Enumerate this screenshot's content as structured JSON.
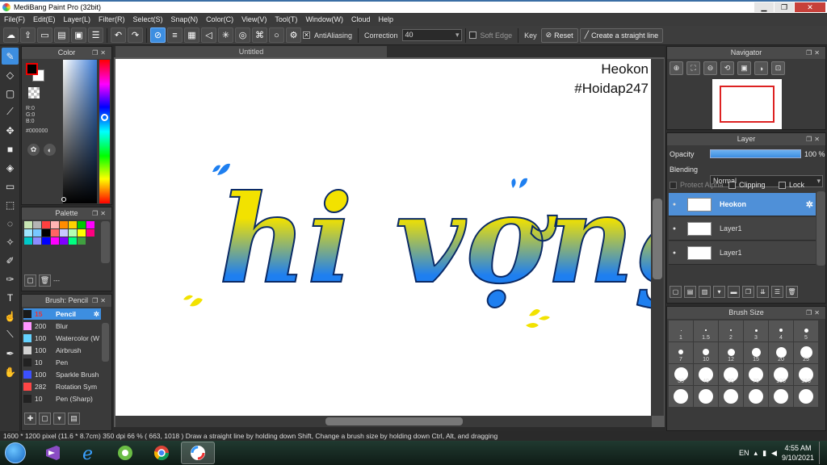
{
  "window": {
    "title": "MediBang Paint Pro (32bit)",
    "minimize": "▁",
    "maximize": "❐",
    "close": "✕"
  },
  "menu": [
    "File(F)",
    "Edit(E)",
    "Layer(L)",
    "Filter(R)",
    "Select(S)",
    "Snap(N)",
    "Color(C)",
    "View(V)",
    "Tool(T)",
    "Window(W)",
    "Cloud",
    "Help"
  ],
  "toolbar": {
    "antialiasing_label": "AntiAliasing",
    "correction_label": "Correction",
    "correction_value": "40",
    "soft_edge_label": "Soft Edge",
    "key_label": "Key",
    "reset_label": "Reset",
    "straight_line_label": "Create a straight line"
  },
  "color_panel": {
    "title": "Color",
    "r": "R:0",
    "g": "G:0",
    "b": "B:0",
    "hex": "#000000"
  },
  "palette_panel": {
    "title": "Palette",
    "colors": [
      "#c8e6b4",
      "#b4b4b4",
      "#ff4040",
      "#ffb4b4",
      "#ff8c00",
      "#ffd200",
      "#00c800",
      "#ff00ff",
      "#a0e6ff",
      "#78c8ff",
      "#000000",
      "#ff6464",
      "#c8c8ff",
      "#b4ffb4",
      "#ffff00",
      "#ff0080",
      "#00c8c8",
      "#8c8cff",
      "#0000ff",
      "#ff00ff",
      "#8000ff",
      "#00ff80",
      "#40a040"
    ],
    "label": "---"
  },
  "brush_panel": {
    "title": "Brush: Pencil",
    "items": [
      {
        "size": "15",
        "name": "Pencil",
        "color": "#1a1a1a"
      },
      {
        "size": "200",
        "name": "Blur",
        "color": "#ff96ff"
      },
      {
        "size": "100",
        "name": "Watercolor (W",
        "color": "#64d2ff"
      },
      {
        "size": "100",
        "name": "Airbrush",
        "color": "#d2d2d2"
      },
      {
        "size": "10",
        "name": "Pen",
        "color": "#222222"
      },
      {
        "size": "100",
        "name": "Sparkle Brush",
        "color": "#3c50ff"
      },
      {
        "size": "282",
        "name": "Rotation Sym",
        "color": "#ff4646"
      },
      {
        "size": "10",
        "name": "Pen (Sharp)",
        "color": "#222222"
      }
    ]
  },
  "canvas": {
    "tab": "Untitled",
    "signature_line1": "Heokon",
    "signature_line2": "#Hoidap247",
    "art_text": "hi vợng"
  },
  "navigator": {
    "title": "Navigator"
  },
  "layer_panel": {
    "title": "Layer",
    "opacity_label": "Opacity",
    "opacity_value": "100 %",
    "blending_label": "Blending",
    "blending_value": "Normal",
    "protect_alpha": "Protect Alpha",
    "clipping": "Clipping",
    "lock": "Lock",
    "layers": [
      {
        "name": "Heokon"
      },
      {
        "name": "Layer1"
      },
      {
        "name": "Layer1"
      }
    ]
  },
  "brush_size_panel": {
    "title": "Brush Size",
    "sizes": [
      "1",
      "1.5",
      "2",
      "3",
      "4",
      "5",
      "7",
      "10",
      "12",
      "15",
      "20",
      "25",
      "30",
      "40",
      "50",
      "70",
      "100",
      "150",
      "",
      "",
      "",
      "",
      "",
      ""
    ]
  },
  "status": {
    "text": "1600 * 1200 pixel   (11.6 * 8.7cm)   350 dpi   66 %   ( 663, 1018 )   Draw a straight line by holding down Shift, Change a brush size by holding down Ctrl, Alt, and dragging"
  },
  "taskbar": {
    "lang": "EN",
    "time": "4:55 AM",
    "date": "9/10/2021"
  }
}
